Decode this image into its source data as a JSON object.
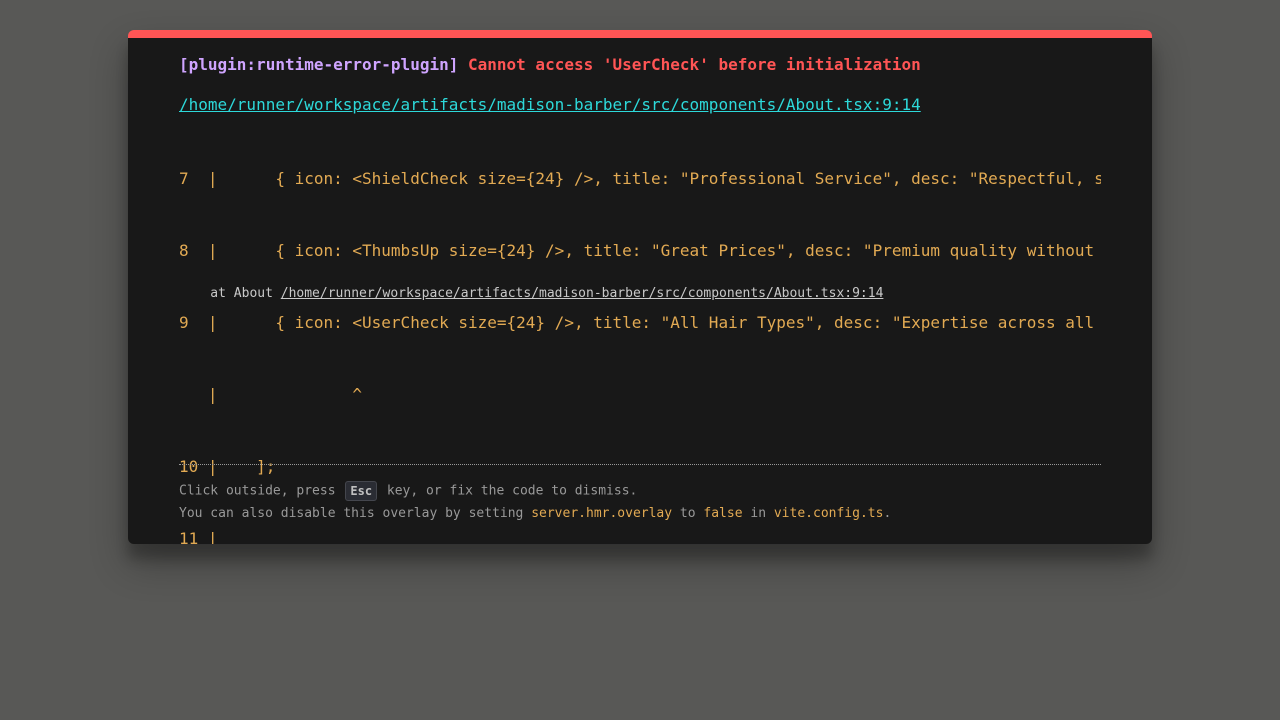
{
  "overlay": {
    "plugin_label": "[plugin:runtime-error-plugin]",
    "error_message": "Cannot access 'UserCheck' before initialization",
    "file_location": "/home/runner/workspace/artifacts/madison-barber/src/components/About.tsx:9:14",
    "code_frame": [
      "7  |      { icon: <ShieldCheck size={24} />, title: \"Professional Service\", desc: \"Respectful, s",
      "8  |      { icon: <ThumbsUp size={24} />, title: \"Great Prices\", desc: \"Premium quality without",
      "9  |      { icon: <UserCheck size={24} />, title: \"All Hair Types\", desc: \"Expertise across all",
      "   |              ^",
      "10 |    ];",
      "11 |"
    ],
    "stack_prefix": "    at About ",
    "stack_location": "/home/runner/workspace/artifacts/madison-barber/src/components/About.tsx:9:14"
  },
  "footer": {
    "tip1_before": "Click outside, press ",
    "tip1_key": "Esc",
    "tip1_after": " key, or fix the code to dismiss.",
    "tip2_before": "You can also disable this overlay by setting ",
    "tip2_setting": "server.hmr.overlay",
    "tip2_to": " to ",
    "tip2_value": "false",
    "tip2_in": " in ",
    "tip2_file": "vite.config.ts",
    "tip2_end": "."
  },
  "colors": {
    "backdrop": "#585856",
    "window_bg": "#181818",
    "accent_red": "#ff5555",
    "plugin_purple": "#cfa4ff",
    "link_cyan": "#2dd9da",
    "code_orange": "#e2aa53",
    "dim_text": "#999999"
  }
}
